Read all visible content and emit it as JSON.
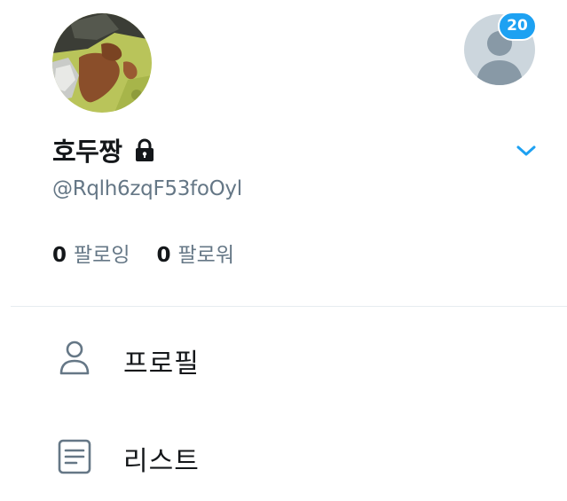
{
  "profile": {
    "display_name": "호두짱",
    "handle": "@Rqlh6zqF53foOyl",
    "protected": true,
    "following_count": "0",
    "following_label": "팔로잉",
    "followers_count": "0",
    "followers_label": "팔로워"
  },
  "account_switcher": {
    "badge_count": "20"
  },
  "menu": {
    "items": [
      {
        "label": "프로필",
        "icon": "person-icon"
      },
      {
        "label": "리스트",
        "icon": "list-icon"
      }
    ]
  },
  "colors": {
    "accent": "#1da1f2",
    "secondary_text": "#657786",
    "primary_text": "#14171a",
    "divider": "#e6ecf0",
    "default_avatar_bg": "#ccd6dd",
    "default_avatar_fg": "#8899a6"
  }
}
